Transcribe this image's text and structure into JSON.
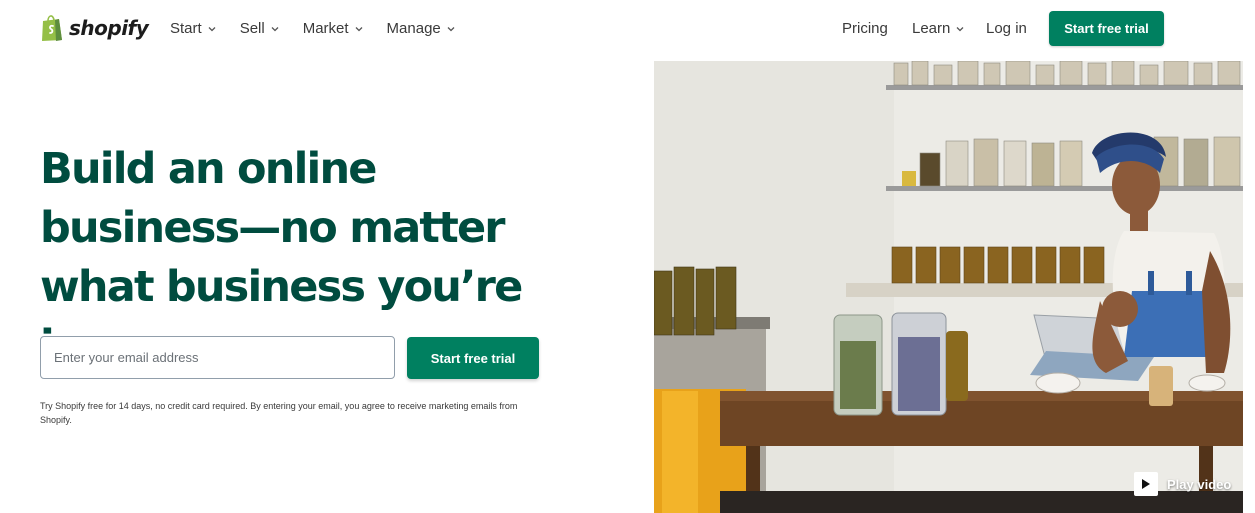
{
  "brand": {
    "name": "shopify",
    "accent": "#008060",
    "headline_color": "#004c3f"
  },
  "nav": {
    "left": [
      {
        "label": "Start",
        "icon": "chevron-down-icon"
      },
      {
        "label": "Sell",
        "icon": "chevron-down-icon"
      },
      {
        "label": "Market",
        "icon": "chevron-down-icon"
      },
      {
        "label": "Manage",
        "icon": "chevron-down-icon"
      }
    ],
    "right": {
      "pricing": "Pricing",
      "learn": "Learn",
      "login": "Log in",
      "cta": "Start free trial"
    }
  },
  "hero": {
    "headline": "Build an online business—no matter what business you’re in",
    "email_placeholder": "Enter your email address",
    "email_value": "",
    "cta": "Start free trial",
    "disclaimer": "Try Shopify free for 14 days, no credit card required. By entering your email, you agree to receive marketing emails from Shopify."
  },
  "media": {
    "play_label": "Play video",
    "icon": "play-icon"
  }
}
